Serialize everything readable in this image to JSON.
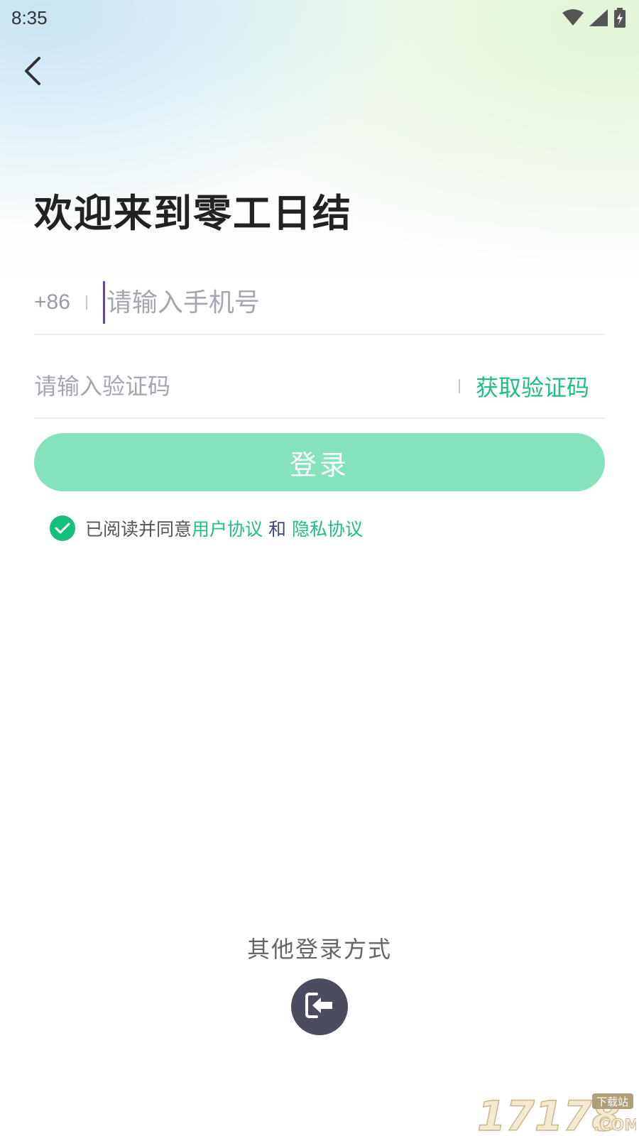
{
  "status_bar": {
    "time": "8:35",
    "icons": [
      "wifi-icon",
      "signal-icon",
      "battery-charging-icon"
    ]
  },
  "header": {
    "back_icon": "chevron-left-icon",
    "title": "欢迎来到零工日结"
  },
  "phone": {
    "country_code": "+86",
    "placeholder": "请输入手机号",
    "value": ""
  },
  "verification": {
    "placeholder": "请输入验证码",
    "value": "",
    "get_code_label": "获取验证码"
  },
  "login_button": {
    "label": "登录"
  },
  "agreement": {
    "checked": true,
    "prefix": "已阅读并同意",
    "user_agreement": "用户协议",
    "and": "和",
    "privacy_policy": "隐私协议"
  },
  "other_login": {
    "label": "其他登录方式",
    "icon": "login-arrow-icon"
  },
  "watermark": {
    "text": "17178",
    "sub_top": "下载站",
    "sub_bottom": ".COM"
  },
  "colors": {
    "accent": "#1fbf7f",
    "login_button_bg": "#84e2bd",
    "checkbox": "#14c07c",
    "title": "#222222",
    "placeholder": "#a6a6b2",
    "alt_login_bg": "#4b4c5d"
  }
}
